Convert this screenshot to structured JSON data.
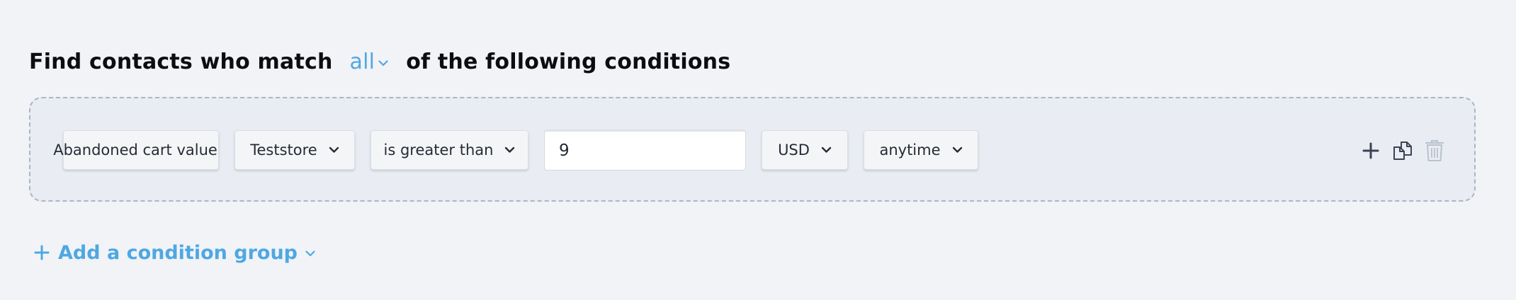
{
  "heading": {
    "prefix": "Find contacts who match",
    "match_value": "all",
    "suffix": "of the following conditions"
  },
  "condition": {
    "field": "Abandoned cart value",
    "store": "Teststore",
    "operator": "is greater than",
    "value": "9",
    "currency": "USD",
    "timeframe": "anytime"
  },
  "actions": {
    "add_icon": "plus-icon",
    "duplicate_icon": "copy-icon",
    "delete_icon": "trash-icon"
  },
  "add_group": {
    "label": "Add a condition group"
  },
  "colors": {
    "accent": "#4ea8e3",
    "background": "#f2f3f6",
    "group_background": "#e9edf3",
    "group_border": "#a9b6c6"
  }
}
